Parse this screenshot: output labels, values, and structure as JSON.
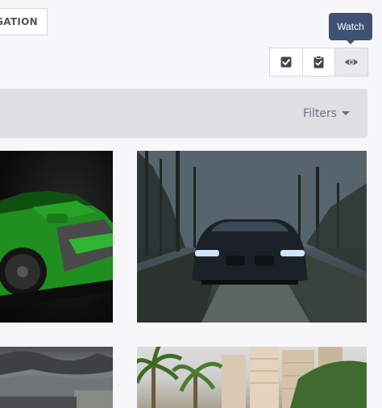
{
  "toolbar": {
    "nav_label": "IGATION",
    "tooltip": "Watch",
    "buttons": [
      {
        "icon": "check-square-icon"
      },
      {
        "icon": "clipboard-check-icon"
      },
      {
        "icon": "eye-icon"
      }
    ]
  },
  "filter_bar": {
    "filters_label": "Filters"
  },
  "gallery": [
    {
      "subject": "green car"
    },
    {
      "subject": "dark car on forest road"
    },
    {
      "subject": "stormy sky"
    },
    {
      "subject": "palm trees and buildings"
    }
  ]
}
